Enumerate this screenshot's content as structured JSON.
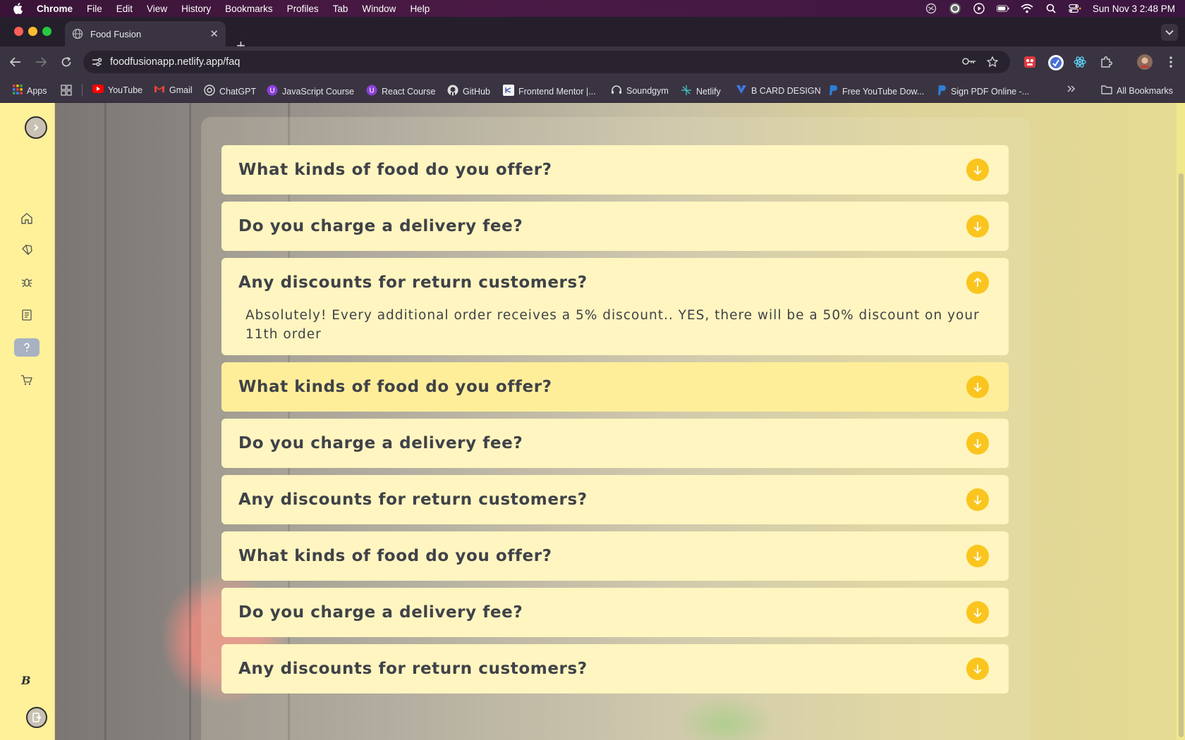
{
  "menubar": {
    "app": "Chrome",
    "items": [
      "File",
      "Edit",
      "View",
      "History",
      "Bookmarks",
      "Profiles",
      "Tab",
      "Window",
      "Help"
    ],
    "clock": "Sun Nov 3  2:48 PM"
  },
  "tab": {
    "title": "Food Fusion"
  },
  "omnibox": {
    "url": "foodfusionapp.netlify.app/faq"
  },
  "bookmarks": {
    "apps": "Apps",
    "items": [
      "YouTube",
      "Gmail",
      "ChatGPT",
      "JavaScript Course",
      "React Course",
      "GitHub",
      "Frontend Mentor |...",
      "Soundgym",
      "Netlify",
      "B CARD DESIGN",
      "Free YouTube Dow...",
      "Sign PDF Online -..."
    ],
    "all": "All Bookmarks"
  },
  "sidebar": {
    "brand": "B",
    "icons": [
      "home-icon",
      "diamond-icon",
      "bug-icon",
      "book-icon",
      "help-icon",
      "cart-icon"
    ],
    "active": "help-icon"
  },
  "faq": {
    "items": [
      {
        "question": "What kinds of food do you offer?",
        "expanded": false
      },
      {
        "question": "Do you charge a delivery fee?",
        "expanded": false
      },
      {
        "question": "Any discounts for return customers?",
        "expanded": true,
        "answer": "Absolutely! Every additional order receives a 5% discount.. YES, there will be a 50% discount on your 11th order"
      },
      {
        "question": "What kinds of food do you offer?",
        "expanded": false,
        "hover": true
      },
      {
        "question": "Do you charge a delivery fee?",
        "expanded": false
      },
      {
        "question": "Any discounts for return customers?",
        "expanded": false
      },
      {
        "question": "What kinds of food do you offer?",
        "expanded": false
      },
      {
        "question": "Do you charge a delivery fee?",
        "expanded": false
      },
      {
        "question": "Any discounts for return customers?",
        "expanded": false
      }
    ]
  },
  "colors": {
    "accent": "#fac51e",
    "sidebar": "#fff19a",
    "card": "#fff5c0",
    "text": "#3f4248"
  }
}
